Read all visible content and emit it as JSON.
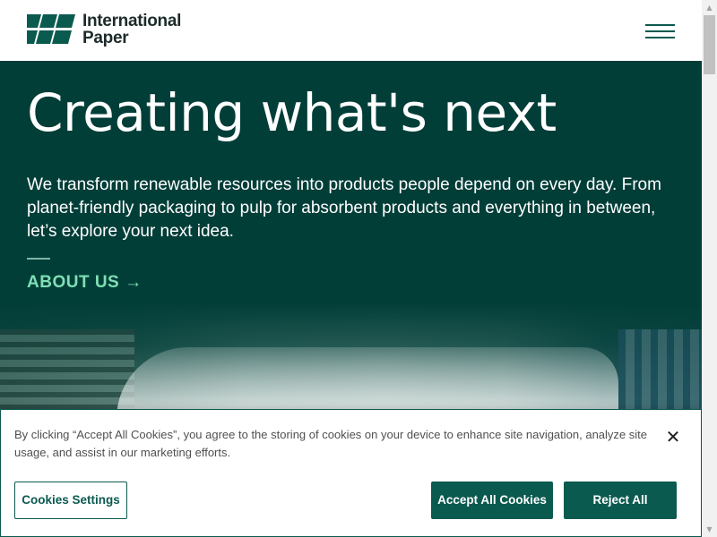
{
  "header": {
    "logo_line1": "International",
    "logo_line2": "Paper",
    "menu_icon": "hamburger-menu-icon"
  },
  "hero": {
    "title": "Creating what's next",
    "description": "We transform renewable resources into products people depend on every day. From planet-friendly packaging to pulp for absorbent products and everything in between, let’s explore your next idea.",
    "link_label": "ABOUT US",
    "link_arrow": "→"
  },
  "cookie_banner": {
    "text": "By clicking “Accept All Cookies”, you agree to the storing of cookies on your device to enhance site navigation, analyze site usage, and assist in our marketing efforts.",
    "close_glyph": "✕",
    "settings_label": "Cookies Settings",
    "accept_label": "Accept All Cookies",
    "reject_label": "Reject All"
  },
  "scrollbar": {
    "up_glyph": "▲",
    "down_glyph": "▼"
  },
  "colors": {
    "brand_green": "#0b5a4f",
    "hero_bg": "#023e38",
    "link_accent": "#7ee0b4"
  }
}
